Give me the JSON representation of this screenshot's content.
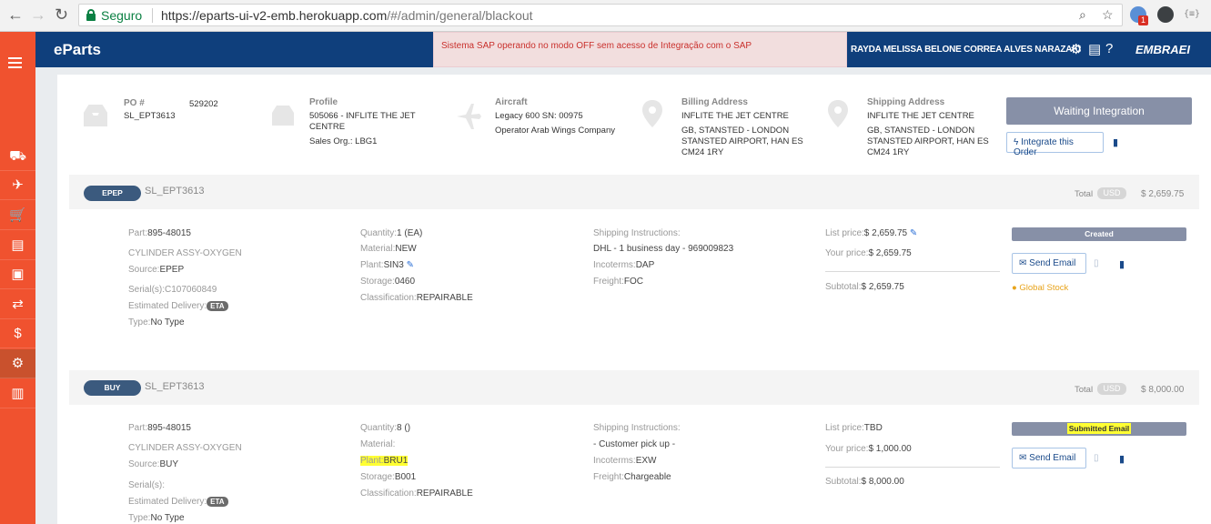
{
  "browser": {
    "secure_label": "Seguro",
    "url_host": "https://eparts-ui-v2-emb.herokuapp.com",
    "url_path": "/#/admin/general/blackout",
    "extension_badge": "1"
  },
  "app": {
    "brand": "eParts",
    "alert": "Sistema SAP operando no modo OFF sem acesso de Integração com o SAP",
    "username": "RAYDA MELISSA BELONE CORREA ALVES NARAZAKI",
    "company_logo": "EMBRAEI"
  },
  "order": {
    "po_label": "PO #",
    "po_number": "529202",
    "po_ref": "SL_EPT3613",
    "profile_label": "Profile",
    "profile_line1": "505066 - INFLITE THE JET",
    "profile_line2": "CENTRE",
    "profile_sales_org": "Sales Org.: LBG1",
    "aircraft_label": "Aircraft",
    "aircraft_line1": "Legacy 600 SN: 00975",
    "aircraft_line2": "Operator Arab Wings Company",
    "billing_label": "Billing Address",
    "billing_line1": "INFLITE THE JET CENTRE",
    "billing_line2": "GB, STANSTED - LONDON",
    "billing_line3": "STANSTED AIRPORT, HAN ES",
    "billing_line4": "CM24 1RY",
    "shipping_label": "Shipping Address",
    "shipping_line1": "INFLITE THE JET CENTRE",
    "shipping_line2": "GB, STANSTED - LONDON",
    "shipping_line3": "STANSTED AIRPORT, HAN ES",
    "shipping_line4": "CM24 1RY",
    "status": "Waiting Integration",
    "integrate_button": "Integrate this Order"
  },
  "sections": [
    {
      "pill": "EPEP",
      "title": "SL_EPT3613",
      "total_label": "Total",
      "currency": "USD",
      "total": "$ 2,659.75",
      "part_label": "Part:",
      "part": "895-48015",
      "description": "CYLINDER ASSY-OXYGEN",
      "source_label": "Source:",
      "source": "EPEP",
      "serials_label": "Serial(s):",
      "serials": "C107060849",
      "delivery_label": "Estimated Delivery:",
      "eta": "ETA",
      "type_label": "Type:",
      "type": "No Type",
      "quantity_label": "Quantity:",
      "quantity": "1 (EA)",
      "material_label": "Material:",
      "material": "NEW",
      "plant_label": "Plant:",
      "plant": "SIN3",
      "storage_label": "Storage:",
      "storage": "0460",
      "classification_label": "Classification:",
      "classification": "REPAIRABLE",
      "ship_instr_label": "Shipping Instructions:",
      "ship_instr": "DHL - 1 business day - 969009823",
      "incoterms_label": "Incoterms:",
      "incoterms": "DAP",
      "freight_label": "Freight:",
      "freight": "FOC",
      "list_price_label": "List price:",
      "list_price": "$ 2,659.75",
      "your_price_label": "Your price:",
      "your_price": "$ 2,659.75",
      "subtotal_label": "Subtotal:",
      "subtotal": "$ 2,659.75",
      "status_badge": "Created",
      "send_email": "Send Email",
      "global_stock": "Global Stock"
    },
    {
      "pill": "BUY",
      "title": "SL_EPT3613",
      "total_label": "Total",
      "currency": "USD",
      "total": "$ 8,000.00",
      "part_label": "Part:",
      "part": "895-48015",
      "description": "CYLINDER ASSY-OXYGEN",
      "source_label": "Source:",
      "source": "BUY",
      "serials_label": "Serial(s):",
      "serials": "",
      "delivery_label": "Estimated Delivery:",
      "eta": "ETA",
      "type_label": "Type:",
      "type": "No Type",
      "quantity_label": "Quantity:",
      "quantity": "8 ()",
      "material_label": "Material:",
      "material": "",
      "plant_label": "Plant:",
      "plant": "BRU1",
      "storage_label": "Storage:",
      "storage": "B001",
      "classification_label": "Classification:",
      "classification": "REPAIRABLE",
      "ship_instr_label": "Shipping Instructions:",
      "ship_instr": "- Customer pick up -",
      "incoterms_label": "Incoterms:",
      "incoterms": "EXW",
      "freight_label": "Freight:",
      "freight": "Chargeable",
      "list_price_label": "List price:",
      "list_price": "TBD",
      "your_price_label": "Your price:",
      "your_price": "$ 1,000.00",
      "subtotal_label": "Subtotal:",
      "subtotal": "$ 8,000.00",
      "status_badge": "Submitted Email",
      "send_email": "Send Email"
    }
  ],
  "colors": {
    "rail": "#f0522f",
    "appbar": "#0f3f7c",
    "status_button": "#8790a7",
    "highlight": "#ffff33"
  }
}
